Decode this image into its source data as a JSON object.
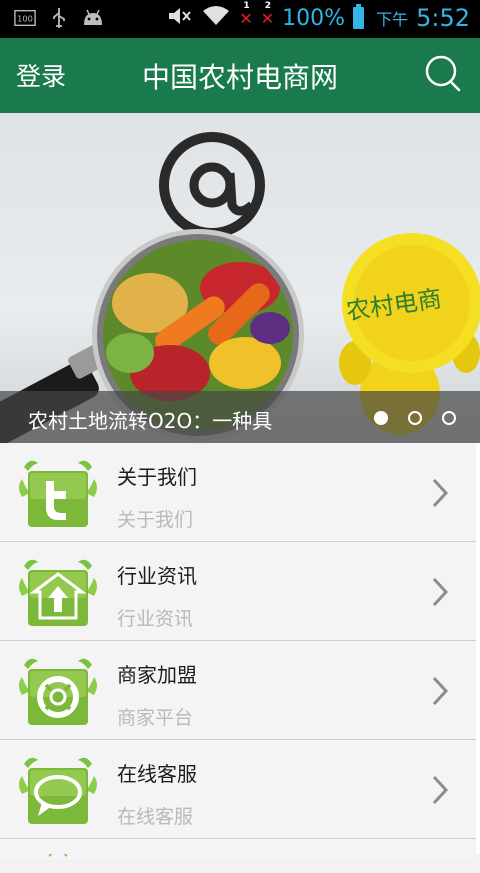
{
  "status_bar": {
    "notification_badge": "100",
    "sim1_label": "1",
    "sim2_label": "2",
    "battery_percent": "100%",
    "ampm": "下午",
    "time": "5:52",
    "accent_color": "#33b5e5"
  },
  "header": {
    "login_label": "登录",
    "title": "中国农村电商网",
    "background_color": "#1a7a4d"
  },
  "banner": {
    "caption": "农村土地流转O2O：一种具",
    "mascot_text": "农村电商",
    "slide_count": 3,
    "active_slide": 1
  },
  "list": [
    {
      "title": "关于我们",
      "subtitle": "关于我们",
      "icon": "twitter-icon"
    },
    {
      "title": "行业资讯",
      "subtitle": "行业资讯",
      "icon": "home-upload-icon"
    },
    {
      "title": "商家加盟",
      "subtitle": "商家平台",
      "icon": "lifebuoy-icon"
    },
    {
      "title": "在线客服",
      "subtitle": "在线客服",
      "icon": "chat-bubble-icon"
    }
  ]
}
